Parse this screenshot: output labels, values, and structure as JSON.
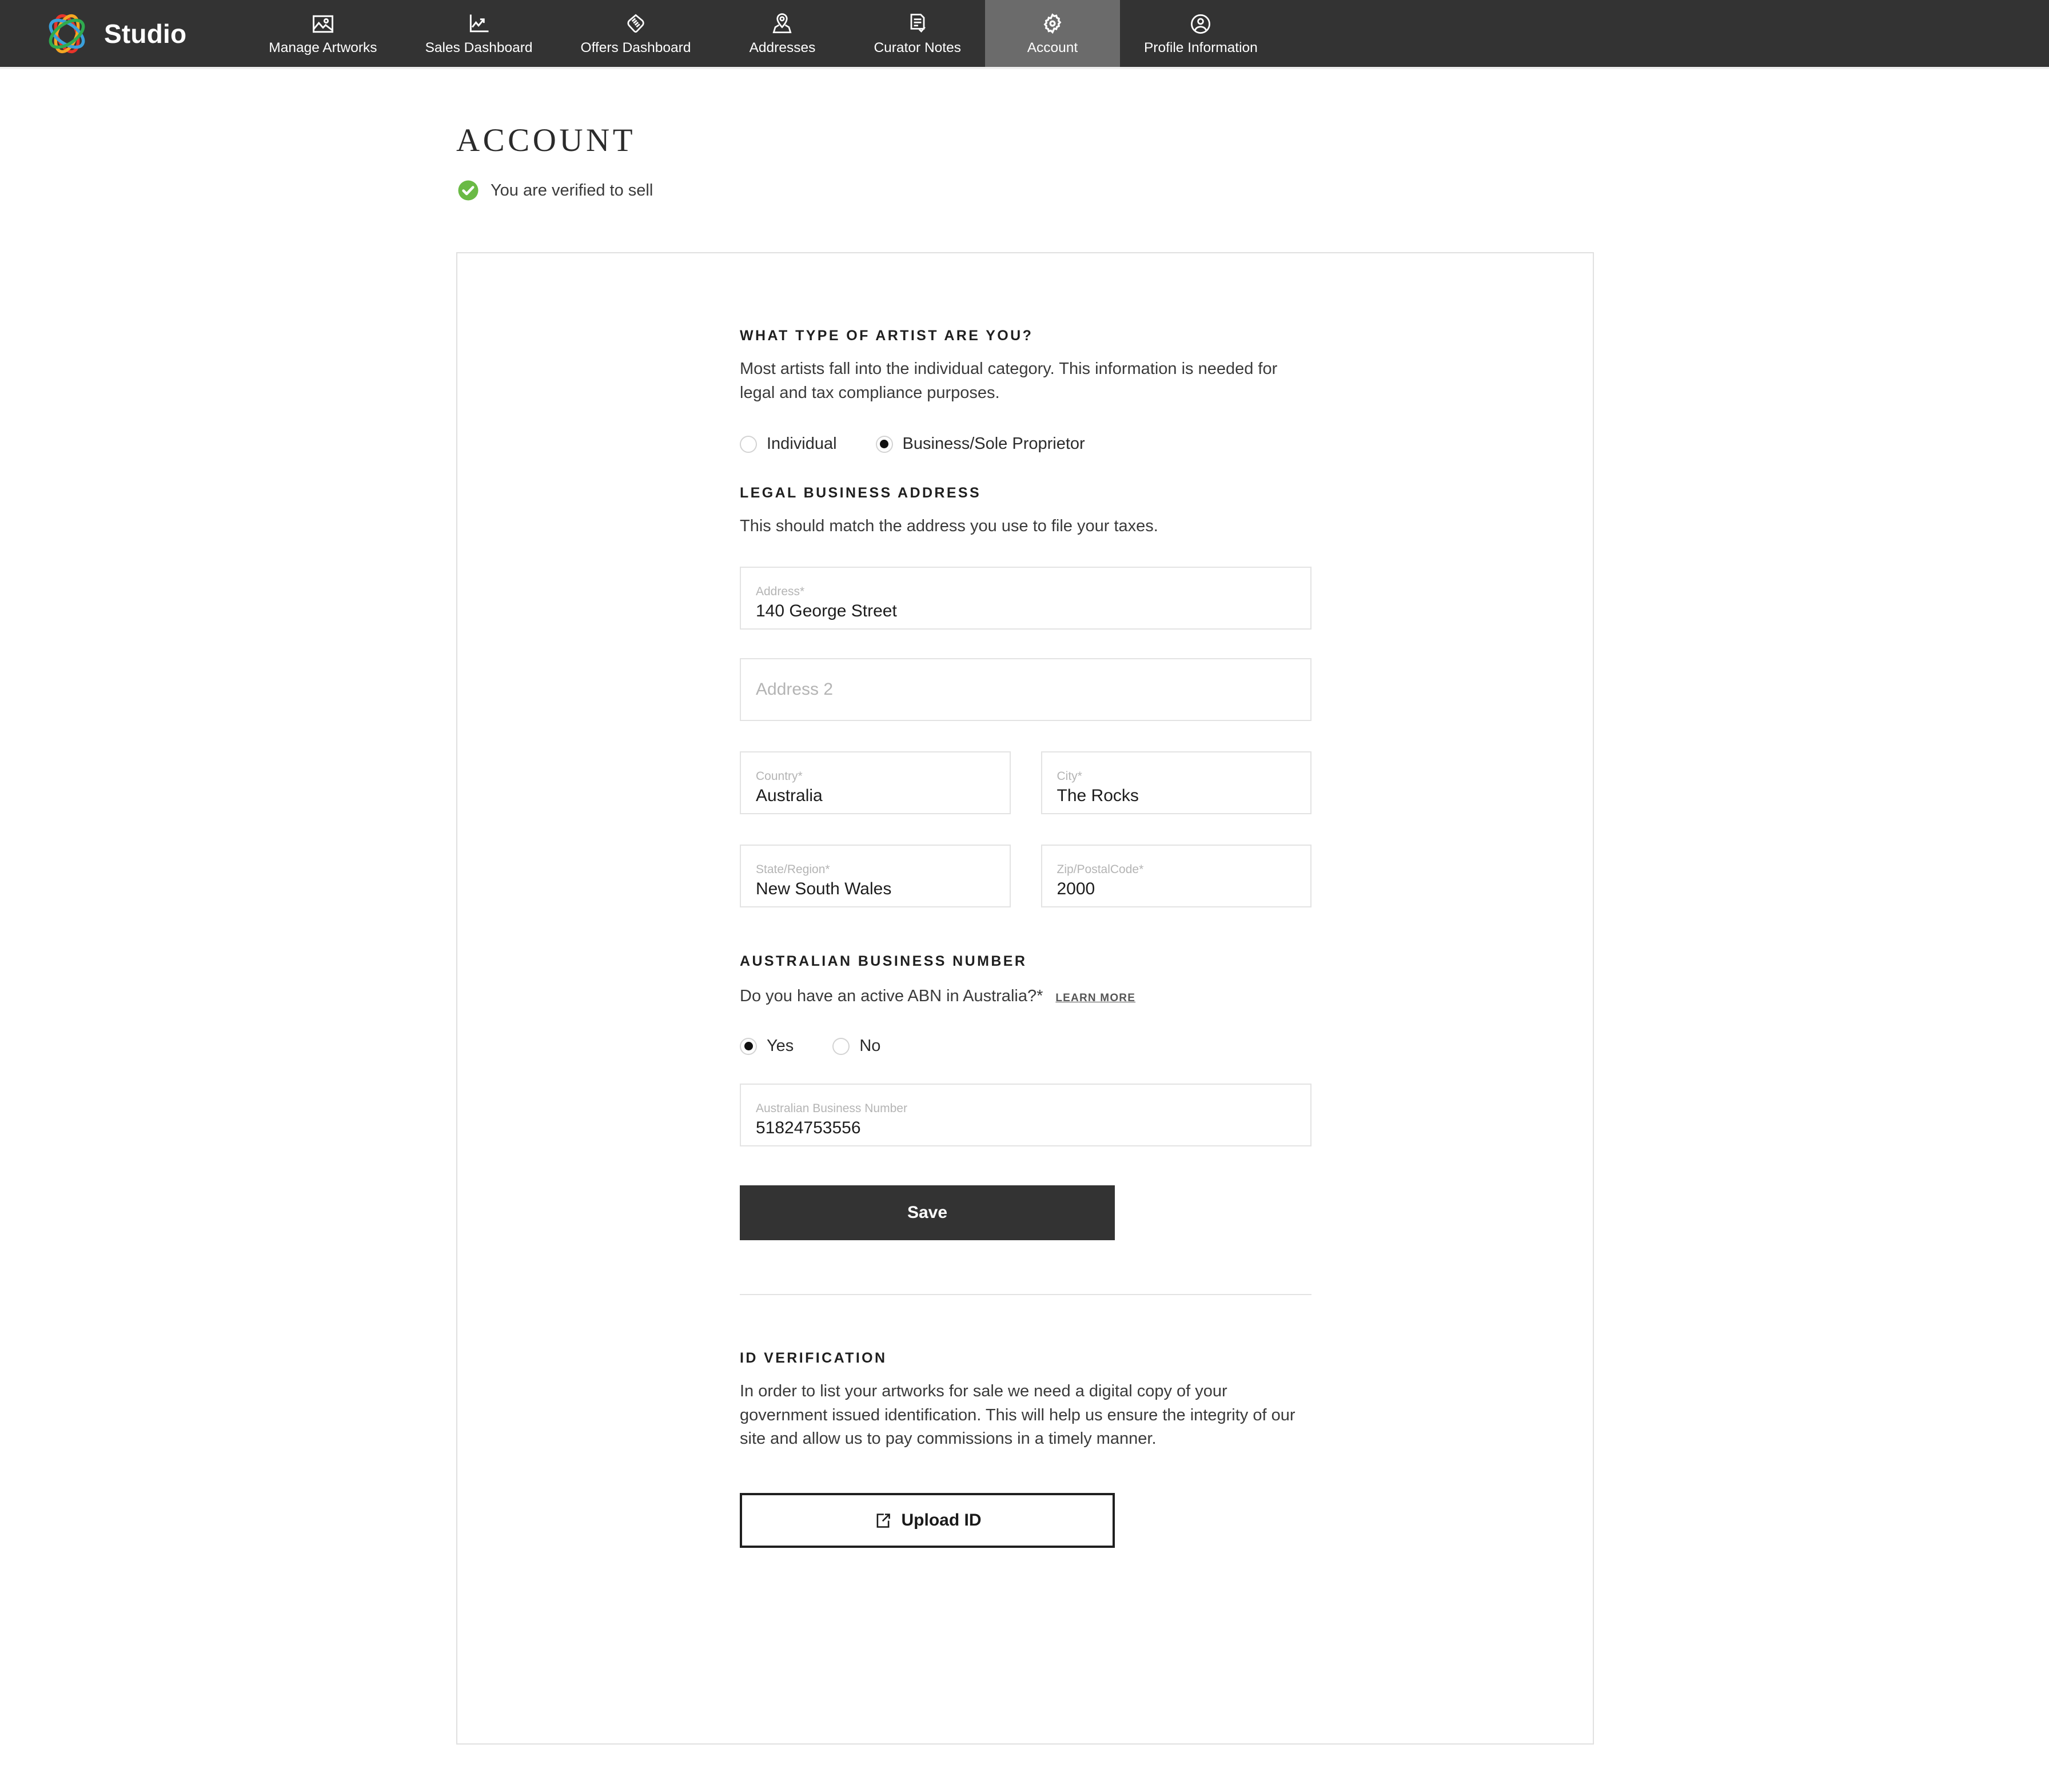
{
  "brand": {
    "name": "Studio",
    "logo_icon": "color-ring-logo"
  },
  "nav": {
    "items": [
      {
        "label": "Manage Artworks",
        "icon": "image-icon",
        "active": false
      },
      {
        "label": "Sales Dashboard",
        "icon": "line-chart-icon",
        "active": false
      },
      {
        "label": "Offers Dashboard",
        "icon": "handshake-icon",
        "active": false
      },
      {
        "label": "Addresses",
        "icon": "map-pin-icon",
        "active": false
      },
      {
        "label": "Curator Notes",
        "icon": "note-check-icon",
        "active": false
      },
      {
        "label": "Account",
        "icon": "gear-icon",
        "active": true
      },
      {
        "label": "Profile Information",
        "icon": "user-circle-icon",
        "active": false
      }
    ]
  },
  "page": {
    "title": "ACCOUNT",
    "verified_text": "You are verified to sell",
    "verified_icon": "check-circle-icon",
    "verified_color": "#6aba45"
  },
  "artist_type": {
    "heading": "WHAT TYPE OF ARTIST ARE YOU?",
    "description": "Most artists fall into the individual category. This information is needed for legal and tax compliance purposes.",
    "options": [
      {
        "label": "Individual",
        "selected": false
      },
      {
        "label": "Business/Sole Proprietor",
        "selected": true
      }
    ]
  },
  "legal_address": {
    "heading": "LEGAL BUSINESS ADDRESS",
    "description": "This should match the address you use to file your taxes.",
    "fields": {
      "address1": {
        "label": "Address*",
        "value": "140 George Street"
      },
      "address2": {
        "label": "",
        "placeholder": "Address 2",
        "value": ""
      },
      "country": {
        "label": "Country*",
        "value": "Australia"
      },
      "city": {
        "label": "City*",
        "value": "The Rocks"
      },
      "state": {
        "label": "State/Region*",
        "value": "New South Wales"
      },
      "zip": {
        "label": "Zip/PostalCode*",
        "value": "2000"
      }
    }
  },
  "abn": {
    "heading": "AUSTRALIAN BUSINESS NUMBER",
    "question": "Do you have an active ABN in Australia?*",
    "learn_more": "LEARN MORE",
    "options": [
      {
        "label": "Yes",
        "selected": true
      },
      {
        "label": "No",
        "selected": false
      }
    ],
    "field": {
      "label": "Australian Business Number",
      "value": "51824753556"
    },
    "save_label": "Save"
  },
  "id_verification": {
    "heading": "ID VERIFICATION",
    "description": "In order to list your artworks for sale we need a digital copy of your government issued identification. This will help us ensure the integrity of our site and allow us to pay commissions in a timely manner.",
    "upload_label": "Upload ID",
    "upload_icon": "external-link-icon"
  },
  "colors": {
    "nav_bg": "#333333",
    "nav_active_bg": "#6b6b6b",
    "accent_dark": "#333333",
    "border": "#e3e3e3",
    "success": "#6aba45"
  }
}
